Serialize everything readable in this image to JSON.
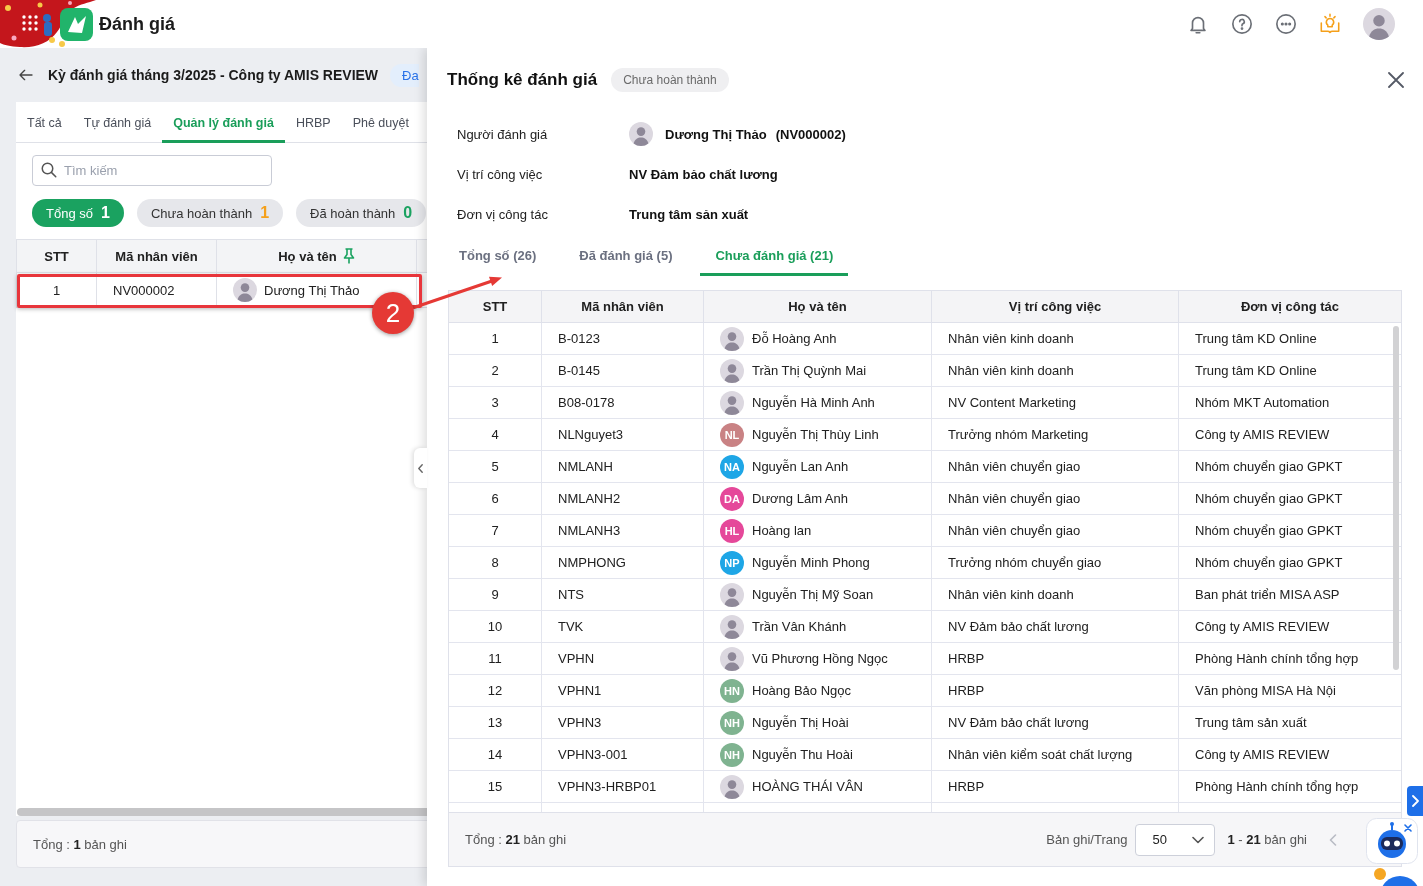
{
  "app_header": {
    "title": "Đánh giá"
  },
  "review_period": {
    "title": "Kỳ đánh giá tháng 3/2025 - Công ty AMIS REVIEW",
    "badge": "Đa"
  },
  "tabs": [
    {
      "label": "Tất cả",
      "selected": false
    },
    {
      "label": "Tự đánh giá",
      "selected": false
    },
    {
      "label": "Quản lý đánh giá",
      "selected": true
    },
    {
      "label": "HRBP",
      "selected": false
    },
    {
      "label": "Phê duyệt",
      "selected": false
    }
  ],
  "search": {
    "placeholder": "Tìm kiếm"
  },
  "filters": [
    {
      "label": "Tổng số",
      "count": "1",
      "selected": true,
      "color": "#ffffff"
    },
    {
      "label": "Chưa hoàn thành",
      "count": "1",
      "selected": false,
      "color": "#f5a01a"
    },
    {
      "label": "Đã hoàn thành",
      "count": "0",
      "selected": false,
      "color": "#1aa260"
    }
  ],
  "table": {
    "columns": [
      {
        "label": "STT",
        "pinned": false
      },
      {
        "label": "Mã nhân viên",
        "pinned": false
      },
      {
        "label": "Họ và tên",
        "pinned": true
      }
    ],
    "rows": [
      {
        "stt": "1",
        "code": "NV000002",
        "name": "Dương Thị Thảo"
      }
    ]
  },
  "footer": "Tổng : **1** bản ghi",
  "annotation": {
    "marker": "2"
  },
  "drawer": {
    "title": "Thống kê đánh giá",
    "status": "Chưa hoàn thành",
    "info": [
      {
        "kind": "person",
        "label": "Người đánh giá",
        "value": "Dương Thị Thảo",
        "code": "(NV000002)"
      },
      {
        "kind": "text",
        "label": "Vị trí công việc",
        "value": "NV Đảm bảo chất lương"
      },
      {
        "kind": "text",
        "label": "Đơn vị công tác",
        "value": "Trung tâm sản xuất"
      }
    ],
    "tabs": [
      {
        "label": "Tổng số (26)",
        "selected": false
      },
      {
        "label": "Đã đánh giá (5)",
        "selected": false
      },
      {
        "label": "Chưa đánh giá (21)",
        "selected": true
      }
    ],
    "table": {
      "columns": [
        "STT",
        "Mã nhân viên",
        "Họ và tên",
        "Vị trí công việc",
        "Đơn vị công tác"
      ],
      "rows": [
        {
          "stt": "1",
          "code": "B-0123",
          "kind": "photo",
          "name": "Đỗ Hoàng Anh",
          "position": "Nhân viên kinh doanh",
          "unit": "Trung tâm KD Online"
        },
        {
          "stt": "2",
          "code": "B-0145",
          "kind": "photo",
          "name": "Trần Thị Quỳnh Mai",
          "position": "Nhân viên kinh doanh",
          "unit": "Trung tâm KD Online"
        },
        {
          "stt": "3",
          "code": "B08-0178",
          "kind": "photo",
          "name": "Nguyễn Hà Minh Anh",
          "position": "NV Content Marketing",
          "unit": "Nhóm MKT Automation"
        },
        {
          "stt": "4",
          "code": "NLNguyet3",
          "kind": "initials",
          "initials": "NL",
          "color": "#c98284",
          "name": "Nguyễn Thị Thùy Linh",
          "position": "Trưởng nhóm Marketing",
          "unit": "Công ty AMIS REVIEW"
        },
        {
          "stt": "5",
          "code": "NMLANH",
          "kind": "initials",
          "initials": "NA",
          "color": "#1ea6e6",
          "name": "Nguyễn Lan Anh",
          "position": "Nhân viên chuyển giao",
          "unit": "Nhóm chuyển giao GPKT"
        },
        {
          "stt": "6",
          "code": "NMLANH2",
          "kind": "initials",
          "initials": "DA",
          "color": "#e5489a",
          "name": "Dương Lâm Anh",
          "position": "Nhân viên chuyển giao",
          "unit": "Nhóm chuyển giao GPKT"
        },
        {
          "stt": "7",
          "code": "NMLANH3",
          "kind": "initials",
          "initials": "HL",
          "color": "#e5489a",
          "name": "Hoàng lan",
          "position": "Nhân viên chuyển giao",
          "unit": "Nhóm chuyển giao GPKT"
        },
        {
          "stt": "8",
          "code": "NMPHONG",
          "kind": "initials",
          "initials": "NP",
          "color": "#1ea6e6",
          "name": "Nguyễn Minh Phong",
          "position": "Trưởng nhóm chuyển giao",
          "unit": "Nhóm chuyển giao GPKT"
        },
        {
          "stt": "9",
          "code": "NTS",
          "kind": "photo",
          "name": "Nguyễn Thị Mỹ Soan",
          "position": "Nhân viên kinh doanh",
          "unit": "Ban phát triển MISA ASP"
        },
        {
          "stt": "10",
          "code": "TVK",
          "kind": "photo",
          "name": "Trần Vân Khánh",
          "position": "NV Đảm bảo chất lương",
          "unit": "Công ty AMIS REVIEW"
        },
        {
          "stt": "11",
          "code": "VPHN",
          "kind": "photo",
          "name": "Vũ Phương Hồng Ngọc",
          "position": "HRBP",
          "unit": "Phòng Hành chính tổng hợp"
        },
        {
          "stt": "12",
          "code": "VPHN1",
          "kind": "initials",
          "initials": "HN",
          "color": "#7fb390",
          "name": "Hoàng Bảo Ngọc",
          "position": "HRBP",
          "unit": "Văn phòng MISA Hà Nội"
        },
        {
          "stt": "13",
          "code": "VPHN3",
          "kind": "initials",
          "initials": "NH",
          "color": "#7fb390",
          "name": "Nguyễn Thị Hoài",
          "position": "NV Đảm bảo chất lương",
          "unit": "Trung tâm sản xuất"
        },
        {
          "stt": "14",
          "code": "VPHN3-001",
          "kind": "initials",
          "initials": "NH",
          "color": "#7fb390",
          "name": "Nguyễn Thu Hoài",
          "position": "Nhân viên kiểm soát chất lượng",
          "unit": "Công ty AMIS REVIEW"
        },
        {
          "stt": "15",
          "code": "VPHN3-HRBP01",
          "kind": "photo",
          "name": "HOÀNG THÁI VÂN",
          "position": "HRBP",
          "unit": "Phòng Hành chính tổng hợp"
        }
      ]
    },
    "footer": {
      "total": "Tổng : **21** bản ghi",
      "page_size_label": "Bản ghi/Trang",
      "page_size": "50",
      "range": "**1** - **21** bản ghi",
      "previous_disabled": true
    }
  }
}
